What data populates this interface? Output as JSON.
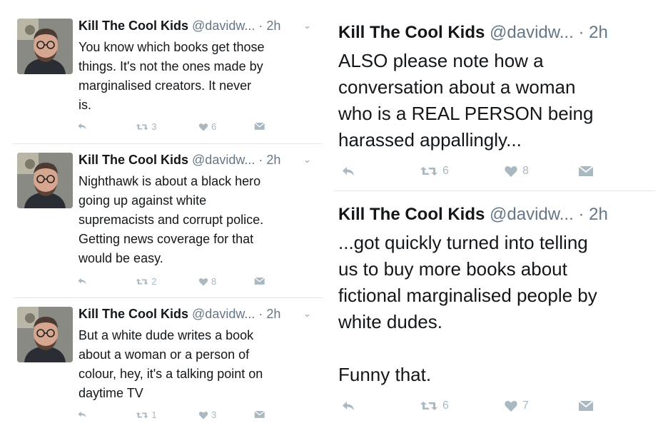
{
  "left_tweets": [
    {
      "name": "Kill The Cool Kids",
      "handle": "@davidw...",
      "time": "· 2h",
      "lines": [
        "You know which books get those",
        "things. It's not the ones made by",
        "marginalised creators. It never",
        "is."
      ],
      "retweets": "3",
      "likes": "6"
    },
    {
      "name": "Kill The Cool Kids",
      "handle": "@davidw...",
      "time": "· 2h",
      "lines": [
        "Nighthawk is about a black hero",
        "going up against white",
        "supremacists and corrupt police.",
        "Getting news coverage for that",
        "would be easy."
      ],
      "retweets": "2",
      "likes": "8"
    },
    {
      "name": "Kill The Cool Kids",
      "handle": "@davidw...",
      "time": "· 2h",
      "lines": [
        "But a white dude writes a book",
        "about a woman or a person of",
        "colour, hey, it's a talking point on",
        "daytime TV"
      ],
      "retweets": "1",
      "likes": "3"
    }
  ],
  "right_tweets": [
    {
      "name": "Kill The Cool Kids",
      "handle": "@davidw...",
      "time": "· 2h",
      "lines": [
        "ALSO please note how a",
        "conversation about a woman",
        "who is a REAL PERSON being",
        "harassed appallingly..."
      ],
      "retweets": "6",
      "likes": "8"
    },
    {
      "name": "Kill The Cool Kids",
      "handle": "@davidw...",
      "time": "· 2h",
      "lines": [
        "...got quickly turned into telling",
        "us to buy more books about",
        "fictional marginalised people by",
        "white dudes.",
        "",
        "Funny that."
      ],
      "retweets": "6",
      "likes": "7"
    }
  ],
  "icons": {
    "reply": "reply-icon",
    "retweet": "retweet-icon",
    "like": "heart-icon",
    "dm": "direct-message-icon",
    "caret": "chevron-down-icon"
  },
  "colors": {
    "text": "#14171a",
    "muted": "#657786",
    "action_gray": "#aab8c2",
    "divider": "#e1e8ed"
  }
}
